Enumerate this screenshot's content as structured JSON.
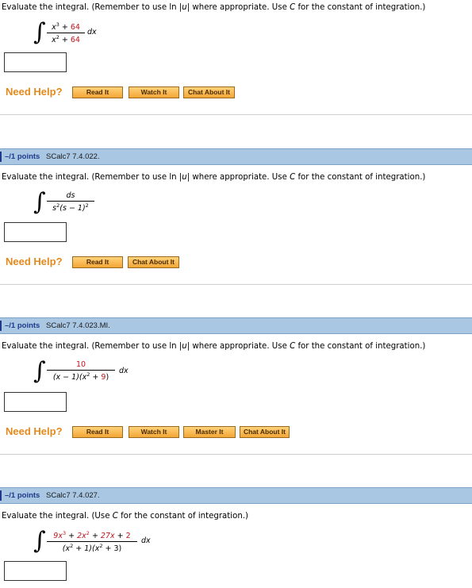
{
  "q1": {
    "prompt_a": "Evaluate the integral. (Remember to use ln |",
    "prompt_u": "u",
    "prompt_b": "| where appropriate. Use ",
    "prompt_c": "C",
    "prompt_d": " for the constant of integration.)",
    "num_x": "x",
    "num_exp": "3",
    "num_rest": " + ",
    "num_const": "64",
    "den_x": "x",
    "den_exp": "2",
    "den_rest": " + ",
    "den_const": "64",
    "dx": "dx",
    "answer_value": "",
    "need_help": "Need Help?",
    "buttons": [
      "Read It",
      "Watch It",
      "Chat About It"
    ]
  },
  "q2": {
    "points": "–/1 points",
    "ref": "SCalc7 7.4.022.",
    "prompt_a": "Evaluate the integral. (Remember to use ln |",
    "prompt_u": "u",
    "prompt_b": "| where appropriate. Use ",
    "prompt_c": "C",
    "prompt_d": " for the constant of integration.)",
    "num": "ds",
    "den_s": "s",
    "den_exp1": "2",
    "den_rest": "(s − 1)",
    "den_exp2": "2",
    "answer_value": "",
    "need_help": "Need Help?",
    "buttons": [
      "Read It",
      "Chat About It"
    ]
  },
  "q3": {
    "points": "–/1 points",
    "ref": "SCalc7 7.4.023.MI.",
    "prompt_a": "Evaluate the integral. (Remember to use ln |",
    "prompt_u": "u",
    "prompt_b": "| where appropriate. Use ",
    "prompt_c": "C",
    "prompt_d": " for the constant of integration.)",
    "num": "10",
    "den_a": "(x − 1)(x",
    "den_exp": "2",
    "den_b": " + ",
    "den_const": "9",
    "den_c": ")",
    "dx": "dx",
    "answer_value": "",
    "need_help": "Need Help?",
    "buttons": [
      "Read It",
      "Watch It",
      "Master It",
      "Chat About It"
    ]
  },
  "q4": {
    "points": "–/1 points",
    "ref": "SCalc7 7.4.027.",
    "prompt_a": "Evaluate the integral. (Use ",
    "prompt_c": "C",
    "prompt_d": " for the constant of integration.)",
    "num_a": "9x",
    "num_exp1": "3",
    "num_b": " + ",
    "num_c": "2x",
    "num_exp2": "2",
    "num_d": " + ",
    "num_e": "27x",
    "num_f": " + ",
    "num_g": "2",
    "den_a": "(x",
    "den_exp1": "2",
    "den_b": " + 1)(x",
    "den_exp2": "2",
    "den_c": " + 3)",
    "dx": "dx",
    "answer_value": ""
  },
  "colors": {
    "need_help": "#e38a1e",
    "button_fill": "#f3a636",
    "question_bar": "#a9c7e3",
    "points_text": "#1f3a8a",
    "red_value": "#c0141c"
  }
}
